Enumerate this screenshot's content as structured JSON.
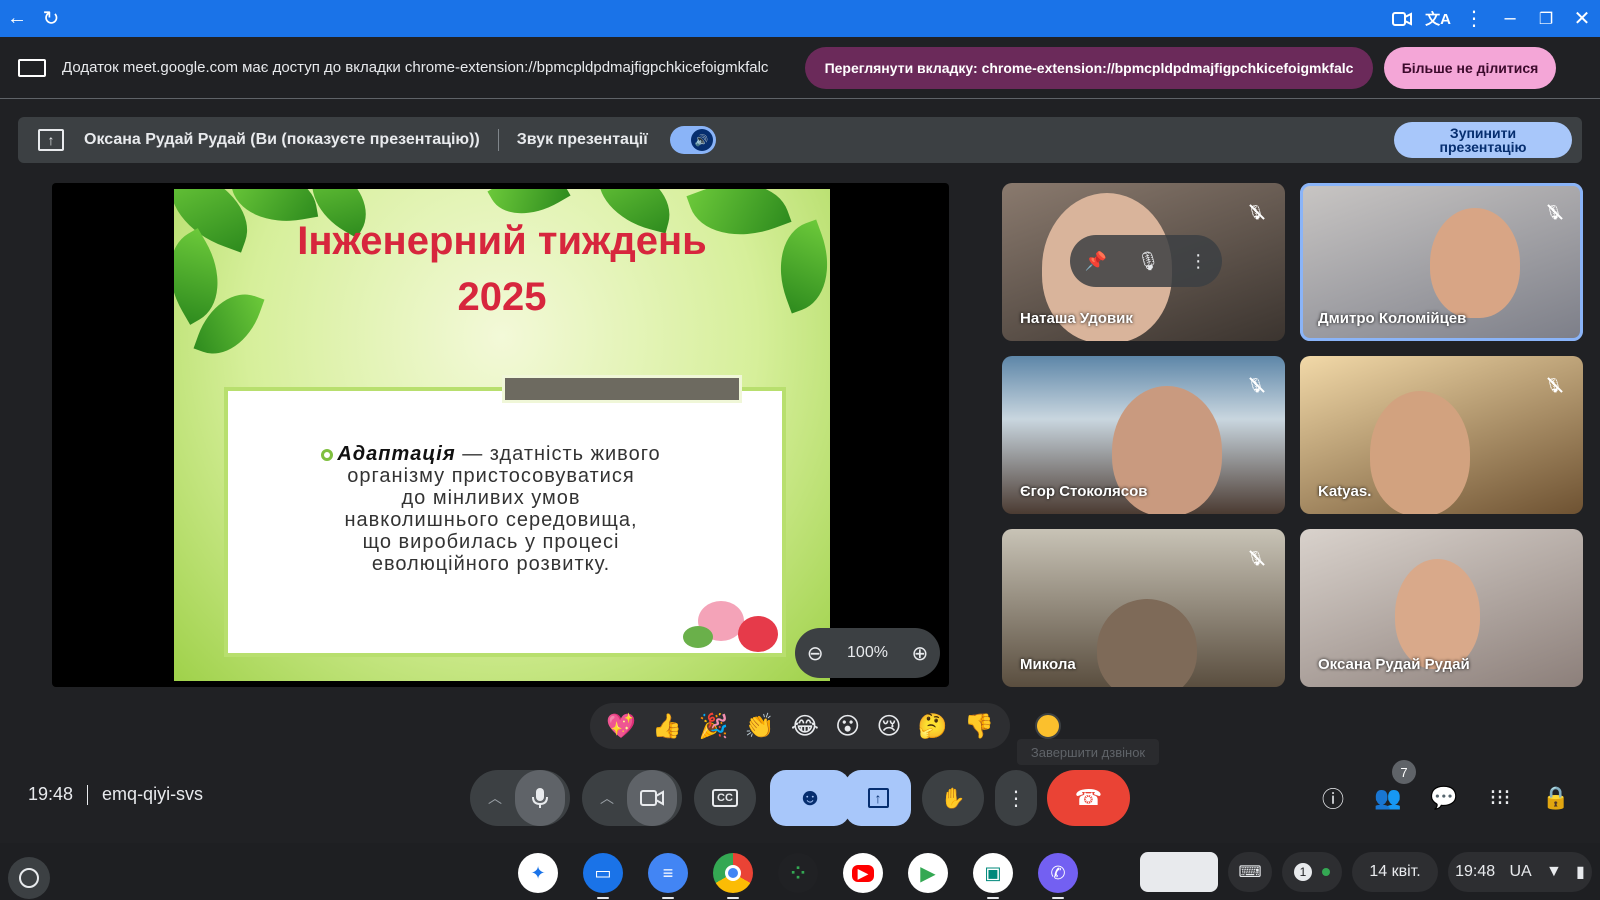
{
  "window": {
    "nav_back_icon": "arrow-left-icon",
    "reload_icon": "reload-icon",
    "controls": [
      "camera-icon",
      "translate-icon",
      "more-vert-icon",
      "minimize-icon",
      "restore-icon",
      "close-icon"
    ]
  },
  "share_bar": {
    "message": "Додаток meet.google.com має доступ до вкладки chrome-extension://bpmcpldpdmajfigpchkicefoigmkfalc",
    "view_tab_label": "Переглянути вкладку: chrome-extension://bpmcpldpdmajfigpchkicefoigmkfalc",
    "stop_sharing_label": "Більше не ділитися"
  },
  "presenting_bar": {
    "presenter": "Оксана Рудай Рудай (Ви (показуєте презентацію))",
    "audio_label": "Звук презентації",
    "audio_on": true,
    "stop_label_line1": "Зупинити",
    "stop_label_line2": "презентацію"
  },
  "slide": {
    "title_line1": "Інженерний тиждень",
    "title_line2": "2025",
    "term": "Адаптація",
    "definition_first": "— здатність живого",
    "definition_lines": [
      "організму пристосовуватися",
      "до мінливих умов",
      "навколишнього середовища,",
      "що виробилась у процесі",
      "еволюційного розвитку."
    ],
    "zoom_level": "100%"
  },
  "participants": [
    {
      "name": "Наташа Удовик",
      "muted": true
    },
    {
      "name": "Дмитро Коломійцев",
      "muted": true,
      "active": true
    },
    {
      "name": "Єгор Стоколясов",
      "muted": true
    },
    {
      "name": "Katyas.",
      "muted": true
    },
    {
      "name": "Микола",
      "muted": true
    },
    {
      "name": "Оксана Рудай Рудай",
      "muted": false
    }
  ],
  "reactions": [
    "💖",
    "👍",
    "🎉",
    "👏",
    "😂",
    "😮",
    "😢",
    "🤔",
    "👎"
  ],
  "tooltip": "Завершити дзвінок",
  "meeting": {
    "time": "19:48",
    "code": "emq-qiyi-svs",
    "participants_count": "7"
  },
  "shelf": {
    "date": "14 квіт.",
    "time": "19:48",
    "locale": "UA",
    "notifications": "1"
  },
  "colors": {
    "accent": "#1a73e8",
    "end_call": "#ea4335",
    "view_tab_pill": "#6b2a5a",
    "stop_pill": "#f4a6d7",
    "slide_title": "#d7263d"
  }
}
